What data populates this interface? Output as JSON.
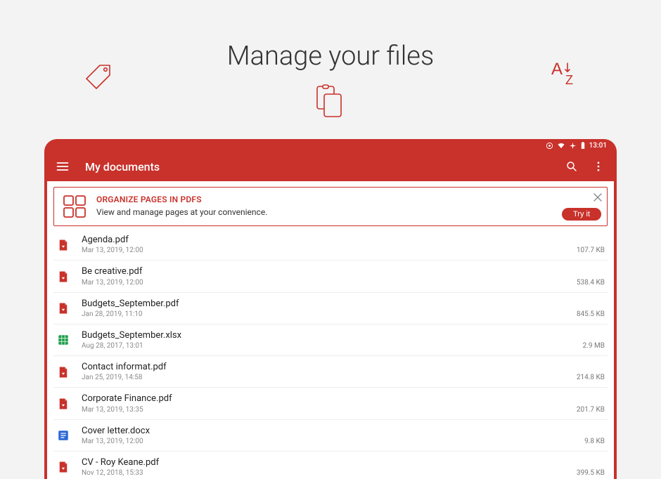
{
  "headline": "Manage your files",
  "statusbar": {
    "time": "13:01"
  },
  "appbar": {
    "title": "My documents"
  },
  "banner": {
    "title": "ORGANIZE PAGES IN PDFS",
    "text": "View and manage pages at your convenience.",
    "try_label": "Try it"
  },
  "files": [
    {
      "name": "Agenda.pdf",
      "date": "Mar 13, 2019, 12:00",
      "size": "107.7 KB",
      "type": "pdf"
    },
    {
      "name": "Be creative.pdf",
      "date": "Mar 13, 2019, 12:00",
      "size": "538.4 KB",
      "type": "pdf"
    },
    {
      "name": "Budgets_September.pdf",
      "date": "Jan 28, 2019, 11:10",
      "size": "845.5 KB",
      "type": "pdf"
    },
    {
      "name": "Budgets_September.xlsx",
      "date": "Aug 28, 2017, 13:01",
      "size": "2.9 MB",
      "type": "xlsx"
    },
    {
      "name": "Contact informat.pdf",
      "date": "Jan 25, 2019, 14:58",
      "size": "214.8 KB",
      "type": "pdf"
    },
    {
      "name": "Corporate Finance.pdf",
      "date": "Mar 13, 2019, 13:35",
      "size": "201.7 KB",
      "type": "pdf"
    },
    {
      "name": "Cover letter.docx",
      "date": "Mar 13, 2019, 12:00",
      "size": "9.8 KB",
      "type": "docx"
    },
    {
      "name": "CV - Roy Keane.pdf",
      "date": "Nov 12, 2018, 15:33",
      "size": "399.5 KB",
      "type": "pdf"
    }
  ],
  "colors": {
    "accent": "#c9312b",
    "xlsx": "#1e9e4a",
    "docx": "#2a67d6"
  }
}
